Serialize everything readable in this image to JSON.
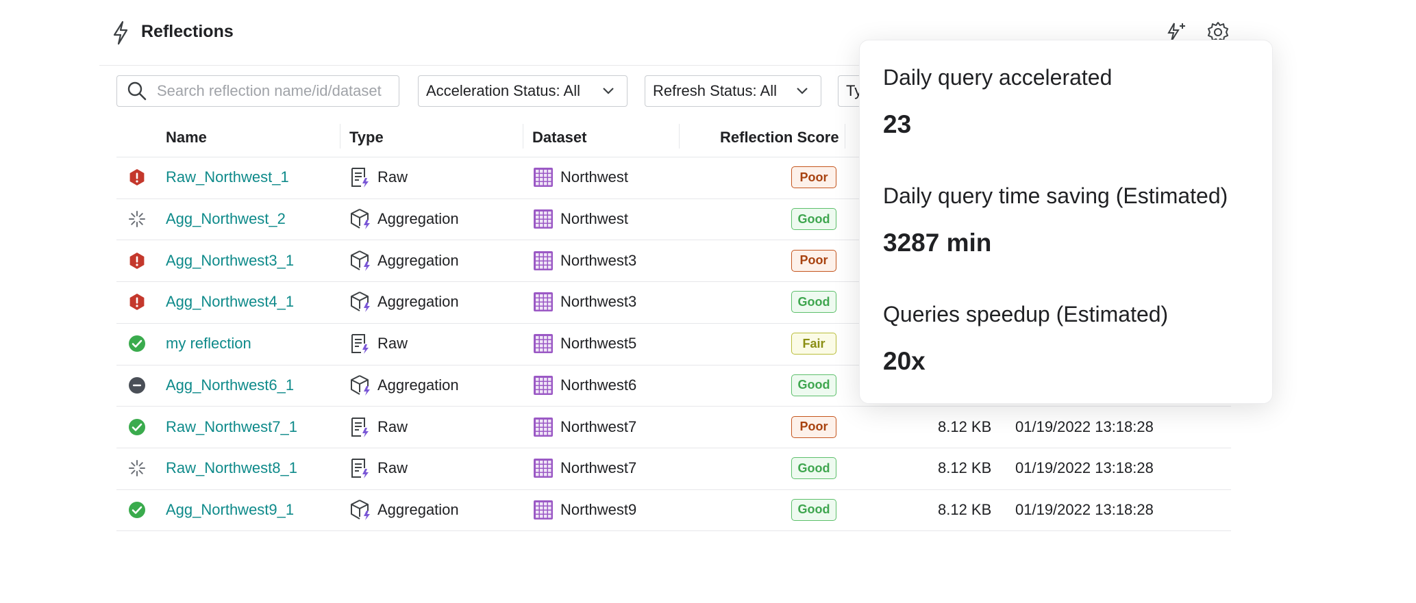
{
  "header": {
    "title": "Reflections"
  },
  "search": {
    "placeholder": "Search reflection name/id/dataset"
  },
  "filters": {
    "acceleration_status": "Acceleration Status: All",
    "refresh_status": "Refresh Status: All",
    "type_partial": "Ty"
  },
  "columns": {
    "name": "Name",
    "type": "Type",
    "dataset": "Dataset",
    "score": "Reflection Score"
  },
  "rows": [
    {
      "status": "error",
      "name": "Raw_Northwest_1",
      "type": "Raw",
      "dataset": "Northwest",
      "score": "Poor",
      "size": "",
      "date": ""
    },
    {
      "status": "loading",
      "name": "Agg_Northwest_2",
      "type": "Aggregation",
      "dataset": "Northwest",
      "score": "Good",
      "size": "",
      "date": ""
    },
    {
      "status": "error",
      "name": "Agg_Northwest3_1",
      "type": "Aggregation",
      "dataset": "Northwest3",
      "score": "Poor",
      "size": "",
      "date": ""
    },
    {
      "status": "error",
      "name": "Agg_Northwest4_1",
      "type": "Aggregation",
      "dataset": "Northwest3",
      "score": "Good",
      "size": "",
      "date": ""
    },
    {
      "status": "success",
      "name": "my reflection",
      "type": "Raw",
      "dataset": "Northwest5",
      "score": "Fair",
      "size": "",
      "date": ""
    },
    {
      "status": "disabled",
      "name": "Agg_Northwest6_1",
      "type": "Aggregation",
      "dataset": "Northwest6",
      "score": "Good",
      "size": "",
      "date": ""
    },
    {
      "status": "success",
      "name": "Raw_Northwest7_1",
      "type": "Raw",
      "dataset": "Northwest7",
      "score": "Poor",
      "size": "8.12 KB",
      "date": "01/19/2022 13:18:28"
    },
    {
      "status": "loading",
      "name": "Raw_Northwest8_1",
      "type": "Raw",
      "dataset": "Northwest7",
      "score": "Good",
      "size": "8.12 KB",
      "date": "01/19/2022 13:18:28"
    },
    {
      "status": "success",
      "name": "Agg_Northwest9_1",
      "type": "Aggregation",
      "dataset": "Northwest9",
      "score": "Good",
      "size": "8.12 KB",
      "date": "01/19/2022 13:18:28"
    }
  ],
  "popover": {
    "daily_accelerated_label": "Daily query accelerated",
    "daily_accelerated_value": "23",
    "time_saving_label": "Daily query time saving (Estimated)",
    "time_saving_value": "3287 min",
    "speedup_label": "Queries speedup (Estimated)",
    "speedup_value": "20x"
  },
  "colors": {
    "link": "#0e8a8a",
    "error": "#c4382c",
    "success": "#3aab4d",
    "disabled": "#4a4f57",
    "dataset_icon": "#9b59c5",
    "type_accent": "#7a57d6"
  },
  "icons": {
    "header": "lightning-icon",
    "top_left": "lightning-sparkle-icon",
    "top_right": "gear-icon",
    "search": "search-icon",
    "chevron": "chevron-down-icon",
    "raw_type": "raw-reflection-icon",
    "aggregation_type": "aggregation-cube-icon",
    "dataset": "dataset-grid-icon"
  }
}
